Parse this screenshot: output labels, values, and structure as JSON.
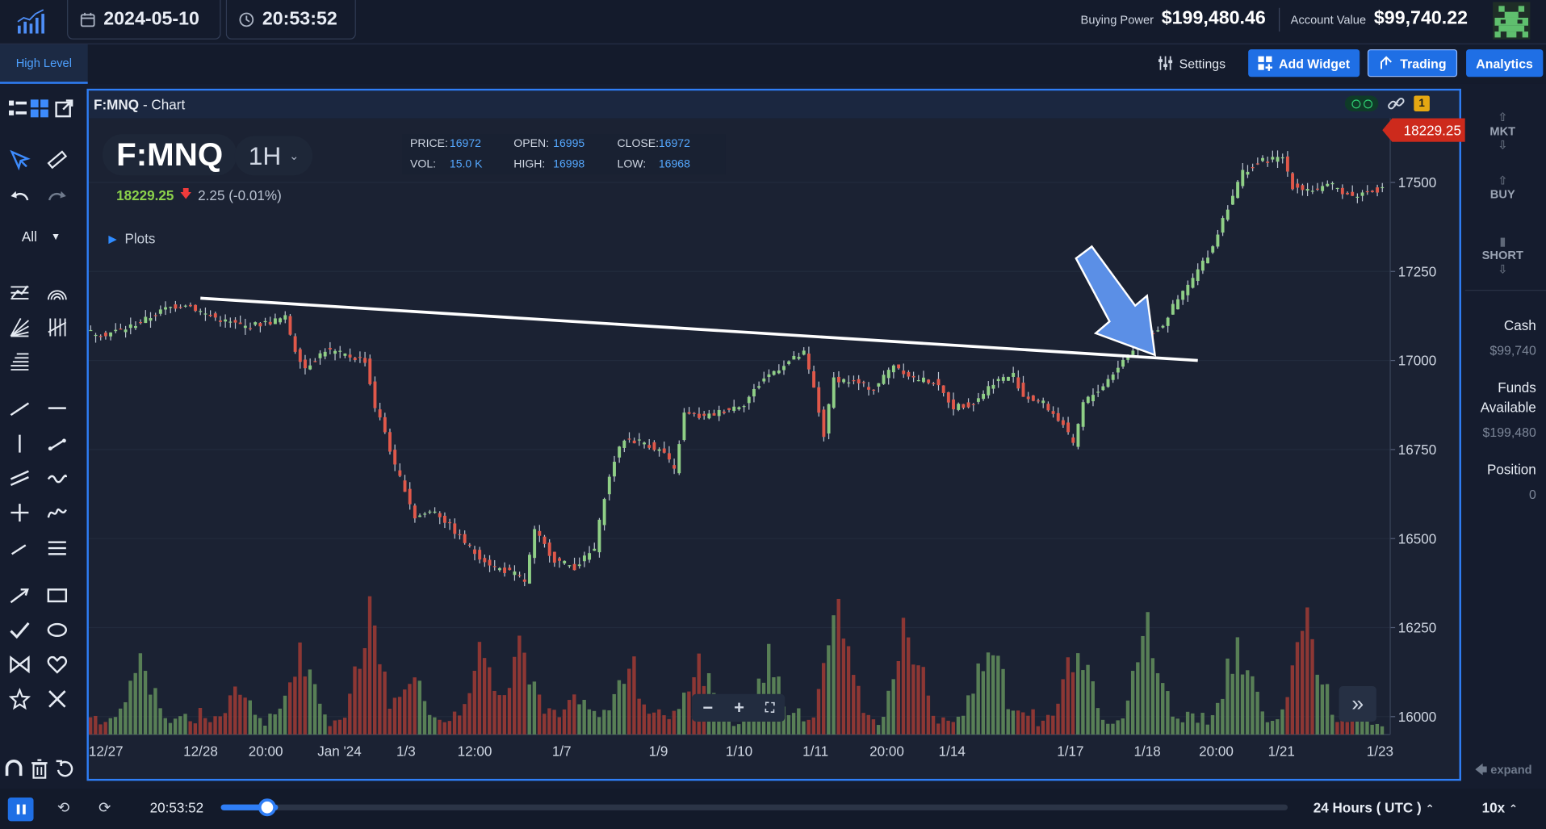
{
  "topbar": {
    "date": "2024-05-10",
    "time": "20:53:52",
    "buying_power_label": "Buying Power",
    "buying_power_value": "$199,480.46",
    "account_value_label": "Account Value",
    "account_value_value": "$99,740.22"
  },
  "toolbar": {
    "layout_tab": "High Level",
    "settings_label": "Settings",
    "add_widget_label": "Add Widget",
    "trading_label": "Trading",
    "analytics_label": "Analytics"
  },
  "left_tools": {
    "filter_label": "All"
  },
  "panel": {
    "symbol_title": "F:MNQ",
    "title_suffix": "- Chart",
    "alert_count": "1"
  },
  "chart_header": {
    "symbol": "F:MNQ",
    "timeframe": "1H",
    "last_price": "18229.25",
    "change": "2.25 (-0.01%)",
    "price_label": "PRICE:",
    "price": "16972",
    "open_label": "OPEN:",
    "open": "16995",
    "close_label": "CLOSE:",
    "close": "16972",
    "vol_label": "VOL:",
    "vol": "15.0 K",
    "high_label": "HIGH:",
    "high": "16998",
    "low_label": "LOW:",
    "low": "16968",
    "plots_label": "Plots",
    "last_tag": "18229.25"
  },
  "chart_data": {
    "type": "candlestick",
    "y_ticks": [
      "17500",
      "17250",
      "17000",
      "16750",
      "16500",
      "16250",
      "16000"
    ],
    "ylim": [
      15950,
      17680
    ],
    "x_labels": [
      "12/27",
      "12/28",
      "20:00",
      "Jan '24",
      "1/3",
      "12:00",
      "1/7",
      "1/9",
      "1/10",
      "1/11",
      "20:00",
      "1/14",
      "1/17",
      "1/18",
      "20:00",
      "1/21",
      "1/23"
    ],
    "close_path": [
      [
        0,
        17080
      ],
      [
        4,
        17075
      ],
      [
        8,
        17090
      ],
      [
        12,
        17115
      ],
      [
        16,
        17145
      ],
      [
        20,
        17160
      ],
      [
        24,
        17130
      ],
      [
        28,
        17110
      ],
      [
        32,
        17095
      ],
      [
        36,
        17105
      ],
      [
        40,
        17120
      ],
      [
        42,
        17030
      ],
      [
        44,
        16980
      ],
      [
        48,
        17030
      ],
      [
        52,
        17015
      ],
      [
        56,
        17000
      ],
      [
        58,
        16870
      ],
      [
        60,
        16800
      ],
      [
        62,
        16700
      ],
      [
        64,
        16640
      ],
      [
        66,
        16560
      ],
      [
        70,
        16580
      ],
      [
        74,
        16520
      ],
      [
        78,
        16460
      ],
      [
        82,
        16420
      ],
      [
        86,
        16400
      ],
      [
        88,
        16380
      ],
      [
        90,
        16520
      ],
      [
        94,
        16440
      ],
      [
        98,
        16420
      ],
      [
        102,
        16470
      ],
      [
        104,
        16620
      ],
      [
        106,
        16720
      ],
      [
        108,
        16780
      ],
      [
        112,
        16770
      ],
      [
        116,
        16740
      ],
      [
        118,
        16690
      ],
      [
        120,
        16850
      ],
      [
        124,
        16840
      ],
      [
        128,
        16860
      ],
      [
        132,
        16880
      ],
      [
        136,
        16950
      ],
      [
        140,
        16990
      ],
      [
        144,
        17020
      ],
      [
        146,
        16920
      ],
      [
        148,
        16790
      ],
      [
        150,
        16950
      ],
      [
        154,
        16940
      ],
      [
        158,
        16920
      ],
      [
        162,
        16990
      ],
      [
        166,
        16950
      ],
      [
        170,
        16940
      ],
      [
        174,
        16870
      ],
      [
        178,
        16880
      ],
      [
        182,
        16940
      ],
      [
        186,
        16960
      ],
      [
        188,
        16900
      ],
      [
        192,
        16880
      ],
      [
        196,
        16820
      ],
      [
        198,
        16760
      ],
      [
        200,
        16880
      ],
      [
        204,
        16930
      ],
      [
        208,
        17000
      ],
      [
        212,
        17060
      ],
      [
        216,
        17100
      ],
      [
        218,
        17150
      ],
      [
        222,
        17230
      ],
      [
        226,
        17320
      ],
      [
        228,
        17400
      ],
      [
        232,
        17530
      ],
      [
        236,
        17560
      ],
      [
        240,
        17570
      ],
      [
        242,
        17490
      ],
      [
        246,
        17480
      ],
      [
        250,
        17490
      ],
      [
        254,
        17460
      ],
      [
        258,
        17480
      ]
    ],
    "volume_peaks": [
      [
        10,
        0.55
      ],
      [
        30,
        0.35
      ],
      [
        42,
        0.6
      ],
      [
        56,
        0.8
      ],
      [
        64,
        0.5
      ],
      [
        78,
        0.6
      ],
      [
        86,
        0.72
      ],
      [
        98,
        0.3
      ],
      [
        108,
        0.55
      ],
      [
        122,
        0.6
      ],
      [
        136,
        0.55
      ],
      [
        150,
        0.95
      ],
      [
        164,
        0.85
      ],
      [
        180,
        0.8
      ],
      [
        198,
        0.78
      ],
      [
        212,
        0.8
      ],
      [
        230,
        0.75
      ],
      [
        244,
        0.88
      ]
    ],
    "trendline": [
      [
        22,
        17175
      ],
      [
        222,
        17000
      ]
    ],
    "arrow_annotation": "pointing to breakout near 1/18 20:00"
  },
  "right_panel": {
    "mkt_label": "MKT",
    "buy_label": "BUY",
    "short_label": "SHORT",
    "cash_label": "Cash",
    "cash_value": "$99,740",
    "funds_label_1": "Funds",
    "funds_label_2": "Available",
    "funds_value": "$199,480",
    "position_label": "Position",
    "position_value": "0",
    "expand_label": "expand"
  },
  "bottombar": {
    "time": "20:53:52",
    "progress": 0.035,
    "timezone": "24 Hours ( UTC )",
    "speed": "10x"
  },
  "colors": {
    "accent": "#2f7ef6",
    "up": "#7dbf72",
    "down": "#d9493b",
    "trend": "#ffffff",
    "arrow": "#5b8fe6"
  }
}
